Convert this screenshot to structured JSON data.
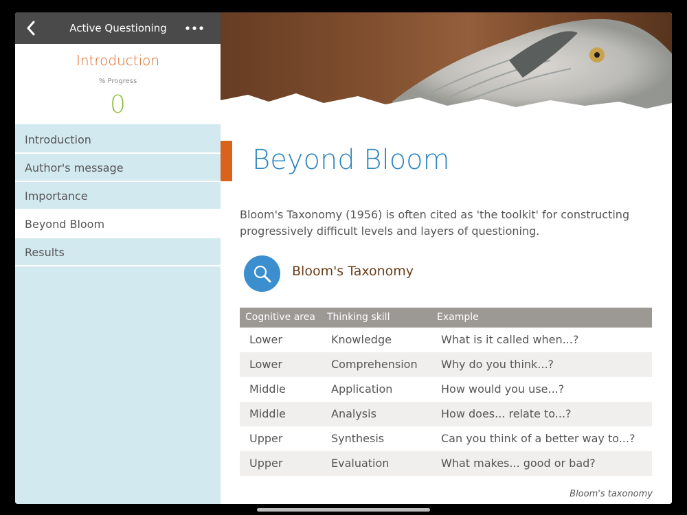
{
  "topbar": {
    "title": "Active Questioning",
    "back_icon": "chevron-left-icon",
    "more_icon": "more-horizontal-icon"
  },
  "progress": {
    "section": "Introduction",
    "label": "% Progress",
    "value": "0"
  },
  "nav": {
    "items": [
      {
        "label": "Introduction"
      },
      {
        "label": "Author's message"
      },
      {
        "label": "Importance"
      },
      {
        "label": "Beyond Bloom",
        "active": true
      },
      {
        "label": "Results"
      }
    ]
  },
  "main": {
    "title": "Beyond Bloom",
    "intro": "Bloom's Taxonomy (1956) is often cited as 'the toolkit' for constructing progressively difficult levels and layers of questioning.",
    "section_title": "Bloom's Taxonomy",
    "section_icon": "magnifier-icon",
    "caption": "Bloom's taxonomy",
    "table": {
      "headers": [
        "Cognitive area",
        "Thinking skill",
        "Example"
      ],
      "rows": [
        [
          "Lower",
          "Knowledge",
          "What is it called when...?"
        ],
        [
          "Lower",
          "Comprehension",
          "Why do you think...?"
        ],
        [
          "Middle",
          "Application",
          "How would you use...?"
        ],
        [
          "Middle",
          "Analysis",
          "How does... relate to...?"
        ],
        [
          "Upper",
          "Synthesis",
          "Can you think of a better way to...?"
        ],
        [
          "Upper",
          "Evaluation",
          "What makes... good or bad?"
        ]
      ]
    }
  },
  "colors": {
    "accent_orange": "#d9621e",
    "title_blue": "#2d84bf",
    "progress_green": "#8fbe3c",
    "sidebar_bg": "#d3e9f0",
    "topbar_bg": "#4a4a4a",
    "table_header": "#9c9894"
  }
}
